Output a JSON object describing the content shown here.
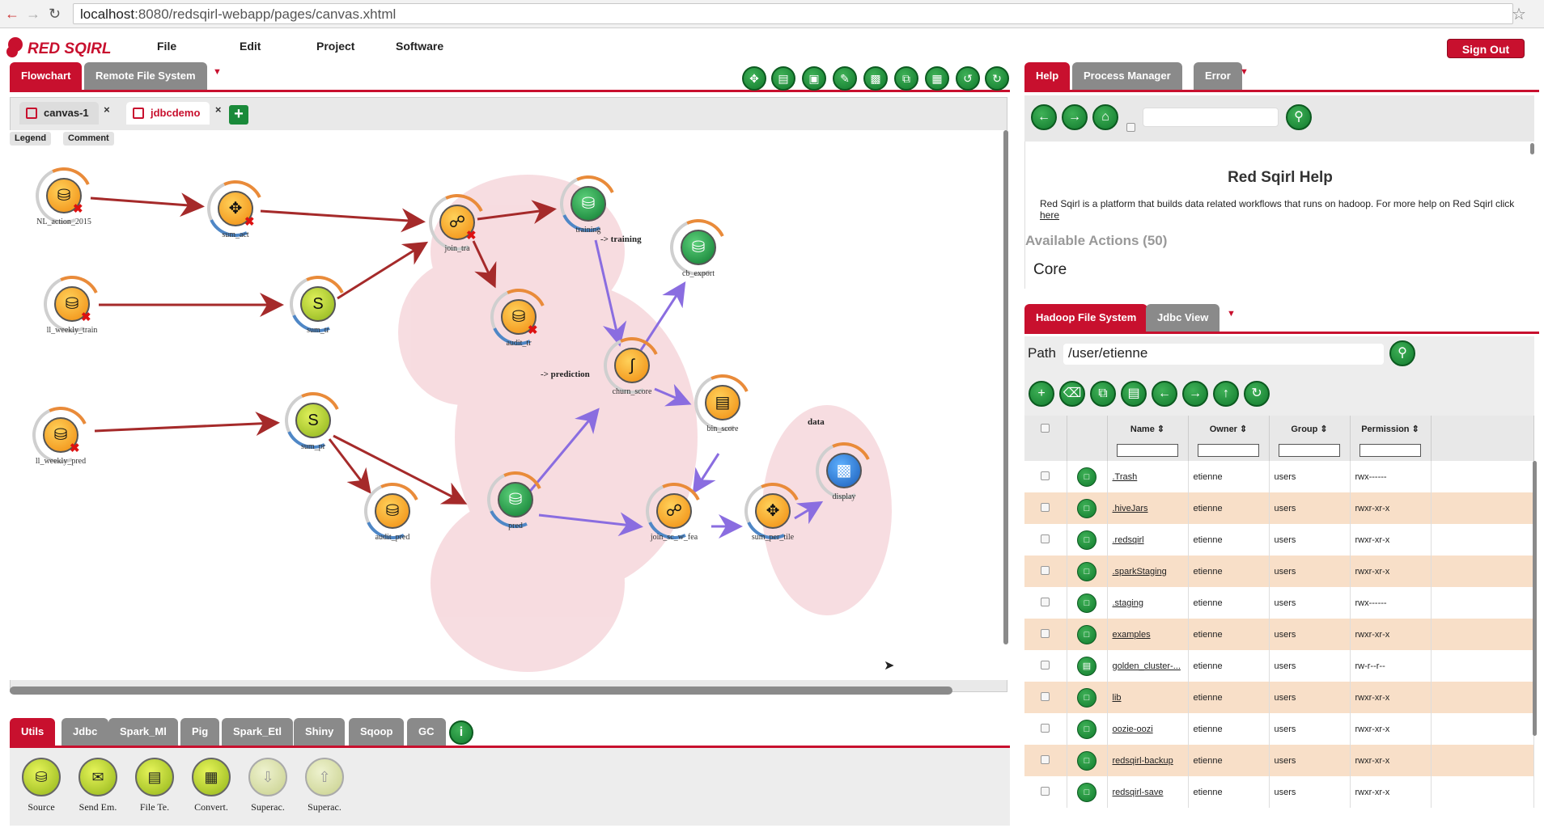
{
  "browser": {
    "url_host": "localhost",
    "url_rest": ":8080/redsqirl-webapp/pages/canvas.xhtml"
  },
  "app": {
    "logo_text": "RED SQIRL",
    "menu": [
      "File",
      "Edit",
      "Project",
      "Software"
    ],
    "sign_out": "Sign Out"
  },
  "left_tabs": [
    "Flowchart",
    "Remote File System"
  ],
  "canvas_tabs": [
    "canvas-1",
    "jdbcdemo"
  ],
  "canvas_buttons": [
    "Legend",
    "Comment"
  ],
  "nodes": [
    {
      "label": "NL_action_2015",
      "type": "or",
      "icon": "database-icon"
    },
    {
      "label": "sum_act",
      "type": "or",
      "icon": "aggregate-icon"
    },
    {
      "label": "join_tra",
      "type": "or",
      "icon": "join-icon"
    },
    {
      "label": "training",
      "type": "gr",
      "icon": "database-icon"
    },
    {
      "label": "cb_export",
      "type": "gr",
      "icon": "database-icon"
    },
    {
      "label": "ll_weekly_train",
      "type": "or",
      "icon": "database-icon"
    },
    {
      "label": "sum_tr",
      "type": "yg",
      "icon": "spark-icon"
    },
    {
      "label": "audit_tr",
      "type": "or",
      "icon": "audit-icon"
    },
    {
      "label": "churn_score",
      "type": "or",
      "icon": "model-icon"
    },
    {
      "label": "bin_score",
      "type": "or",
      "icon": "bin-icon"
    },
    {
      "label": "ll_weekly_pred",
      "type": "or",
      "icon": "database-icon"
    },
    {
      "label": "sum_pr",
      "type": "yg",
      "icon": "spark-icon"
    },
    {
      "label": "audit_pred",
      "type": "or",
      "icon": "audit-icon"
    },
    {
      "label": "pred",
      "type": "gr",
      "icon": "database-icon"
    },
    {
      "label": "join_sc_w_fea",
      "type": "or",
      "icon": "join-icon"
    },
    {
      "label": "sum_per_tile",
      "type": "or",
      "icon": "aggregate-icon"
    },
    {
      "label": "display",
      "type": "bl",
      "icon": "chart-icon"
    }
  ],
  "edge_labels": [
    "-> training",
    "-> prediction",
    "data"
  ],
  "palette_tabs": [
    "Utils",
    "Jdbc",
    "Spark_Ml",
    "Pig",
    "Spark_Etl",
    "Shiny",
    "Sqoop",
    "GC"
  ],
  "palette_tools": [
    {
      "label": "Source",
      "dim": false
    },
    {
      "label": "Send Em.",
      "dim": false
    },
    {
      "label": "File Te.",
      "dim": false
    },
    {
      "label": "Convert.",
      "dim": false
    },
    {
      "label": "Superac.",
      "dim": true
    },
    {
      "label": "Superac.",
      "dim": true
    }
  ],
  "right_top_tabs": [
    "Help",
    "Process Manager",
    "Error"
  ],
  "help": {
    "title": "Red Sqirl Help",
    "text": "Red Sqirl is a platform that builds data related workflows that runs on hadoop. For more help on Red Sqirl click",
    "link": "here",
    "actions_heading": "Available Actions (50)",
    "core": "Core"
  },
  "right_bottom_tabs": [
    "Hadoop File System",
    "Jdbc View"
  ],
  "fs": {
    "path_label": "Path",
    "path_value": "/user/etienne",
    "columns": [
      "Name",
      "Owner",
      "Group",
      "Permission"
    ],
    "rows": [
      {
        "name": ".Trash",
        "owner": "etienne",
        "group": "users",
        "perm": "rwx------",
        "kind": "folder"
      },
      {
        "name": ".hiveJars",
        "owner": "etienne",
        "group": "users",
        "perm": "rwxr-xr-x",
        "kind": "folder"
      },
      {
        "name": ".redsqirl",
        "owner": "etienne",
        "group": "users",
        "perm": "rwxr-xr-x",
        "kind": "folder"
      },
      {
        "name": ".sparkStaging",
        "owner": "etienne",
        "group": "users",
        "perm": "rwxr-xr-x",
        "kind": "folder"
      },
      {
        "name": ".staging",
        "owner": "etienne",
        "group": "users",
        "perm": "rwx------",
        "kind": "folder"
      },
      {
        "name": "examples",
        "owner": "etienne",
        "group": "users",
        "perm": "rwxr-xr-x",
        "kind": "folder"
      },
      {
        "name": "golden_cluster-...",
        "owner": "etienne",
        "group": "users",
        "perm": "rw-r--r--",
        "kind": "file"
      },
      {
        "name": "lib",
        "owner": "etienne",
        "group": "users",
        "perm": "rwxr-xr-x",
        "kind": "folder"
      },
      {
        "name": "oozie-oozi",
        "owner": "etienne",
        "group": "users",
        "perm": "rwxr-xr-x",
        "kind": "folder"
      },
      {
        "name": "redsqirl-backup",
        "owner": "etienne",
        "group": "users",
        "perm": "rwxr-xr-x",
        "kind": "folder"
      },
      {
        "name": "redsqirl-save",
        "owner": "etienne",
        "group": "users",
        "perm": "rwxr-xr-x",
        "kind": "folder"
      }
    ]
  },
  "colors": {
    "brand": "#c8102e",
    "edge_red": "#a52a2a",
    "edge_purple": "#8a6de0"
  }
}
